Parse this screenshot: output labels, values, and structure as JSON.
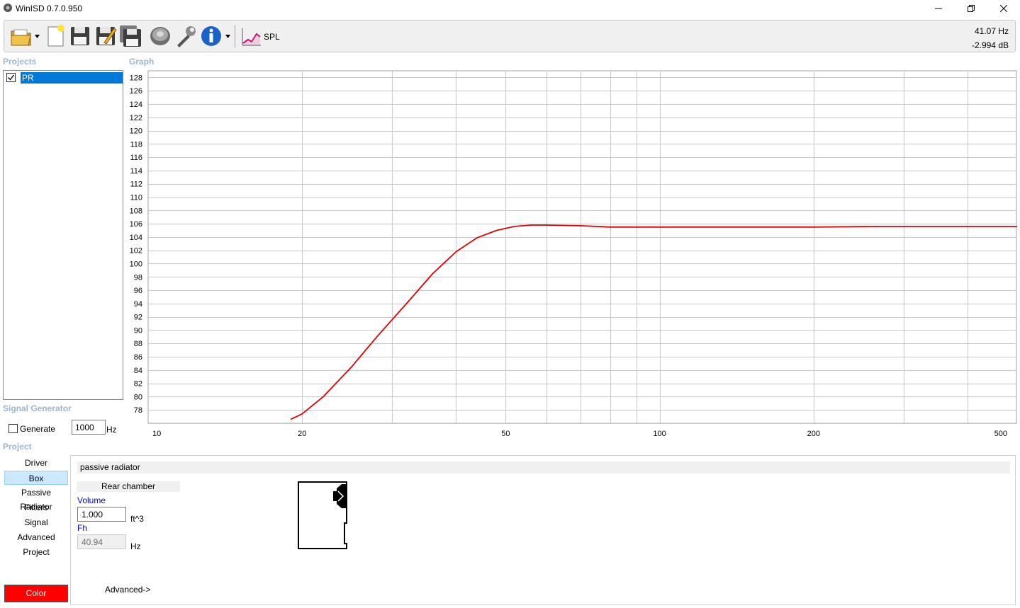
{
  "window": {
    "title": "WinISD 0.7.0.950"
  },
  "toolbar": {
    "spl_label": "SPL",
    "cursor_freq": "41.07 Hz",
    "cursor_db": "-2.994 dB",
    "icons": [
      "folder-open-icon",
      "new-document-icon",
      "save-icon",
      "save-as-icon",
      "save-all-icon",
      "speaker-icon",
      "wrench-icon",
      "info-icon",
      "spl-graph-icon"
    ]
  },
  "projects": {
    "heading": "Projects",
    "items": [
      {
        "label": "PR",
        "checked": true,
        "selected": true
      }
    ]
  },
  "signal_generator": {
    "heading": "Signal Generator",
    "generate_label": "Generate",
    "generate_checked": false,
    "frequency": "1000",
    "unit": "Hz"
  },
  "graph": {
    "heading": "Graph"
  },
  "chart_data": {
    "type": "line",
    "title": "",
    "xlabel": "",
    "ylabel": "",
    "xscale": "log",
    "xlim": [
      10,
      500
    ],
    "ylim": [
      76,
      129
    ],
    "x_tick_labels": [
      "10",
      "20",
      "50",
      "100",
      "200",
      "500"
    ],
    "y_tick_labels": [
      "78",
      "80",
      "82",
      "84",
      "86",
      "88",
      "90",
      "92",
      "94",
      "96",
      "98",
      "100",
      "102",
      "104",
      "106",
      "108",
      "110",
      "112",
      "114",
      "116",
      "118",
      "120",
      "122",
      "124",
      "126",
      "128"
    ],
    "grid": true,
    "series": [
      {
        "color": "#e00000",
        "x": [
          19,
          20,
          22,
          25,
          28,
          32,
          36,
          40,
          44,
          48,
          52,
          56,
          60,
          70,
          80,
          100,
          150,
          200,
          270,
          300,
          400,
          500
        ],
        "y": [
          76.6,
          77.4,
          80,
          84.5,
          89,
          94,
          98.5,
          101.8,
          103.9,
          105,
          105.6,
          105.8,
          105.8,
          105.7,
          105.5,
          105.5,
          105.5,
          105.5,
          105.6,
          105.6,
          105.6,
          105.6
        ]
      }
    ]
  },
  "project_section": {
    "heading": "Project",
    "nav": [
      {
        "label": "Driver",
        "active": false
      },
      {
        "label": "Box",
        "active": true
      },
      {
        "label": "Passive Radiator",
        "active": false
      },
      {
        "label": "Filters",
        "active": false
      },
      {
        "label": "Signal",
        "active": false
      },
      {
        "label": "Advanced",
        "active": false
      },
      {
        "label": "Project",
        "active": false
      }
    ],
    "color_button": "Color",
    "color_value": "#ff0000"
  },
  "box": {
    "type_label": "passive radiator",
    "rear_chamber": "Rear chamber",
    "volume_label": "Volume",
    "volume_value": "1.000",
    "volume_unit": "ft^3",
    "fh_label": "Fh",
    "fh_value": "40.94",
    "fh_unit": "Hz",
    "advanced_link": "Advanced->"
  }
}
